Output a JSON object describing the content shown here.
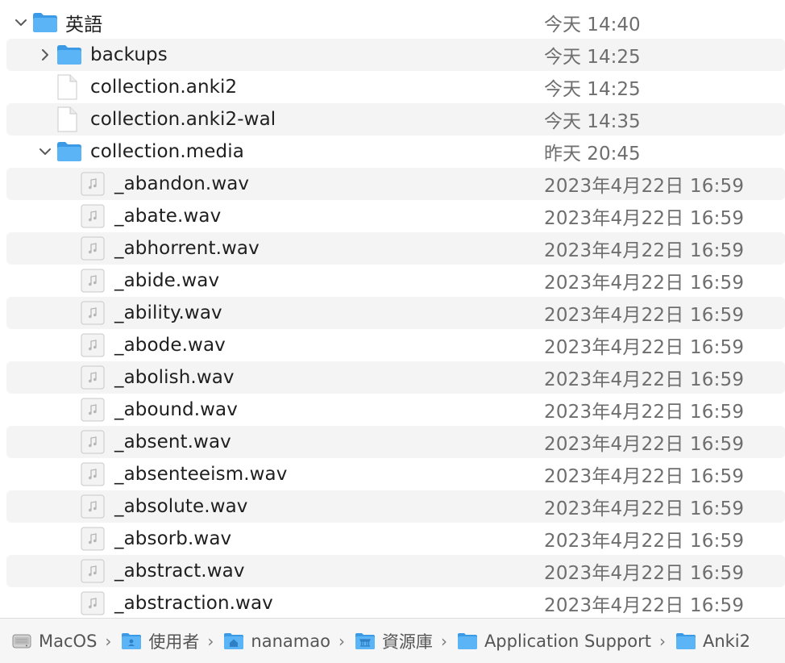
{
  "colors": {
    "folder_blue": "#4aa8f0",
    "folder_tab": "#62b6f5",
    "stripe": "#f4f4f5",
    "date_text": "#6e6e6e"
  },
  "rows": [
    {
      "name": "英語",
      "date": "今天 14:40",
      "type": "folder",
      "expanded": true,
      "icon": "folder-icon"
    },
    {
      "name": "backups",
      "date": "今天 14:25",
      "type": "folder",
      "expanded": false,
      "icon": "folder-icon"
    },
    {
      "name": "collection.anki2",
      "date": "今天 14:25",
      "type": "file",
      "icon": "document-icon"
    },
    {
      "name": "collection.anki2-wal",
      "date": "今天 14:35",
      "type": "file",
      "icon": "document-icon"
    },
    {
      "name": "collection.media",
      "date": "昨天 20:45",
      "type": "folder",
      "expanded": true,
      "icon": "folder-icon"
    },
    {
      "name": "_abandon.wav",
      "date": "2023年4月22日 16:59",
      "type": "audio",
      "icon": "audio-file-icon"
    },
    {
      "name": "_abate.wav",
      "date": "2023年4月22日 16:59",
      "type": "audio",
      "icon": "audio-file-icon"
    },
    {
      "name": "_abhorrent.wav",
      "date": "2023年4月22日 16:59",
      "type": "audio",
      "icon": "audio-file-icon"
    },
    {
      "name": "_abide.wav",
      "date": "2023年4月22日 16:59",
      "type": "audio",
      "icon": "audio-file-icon"
    },
    {
      "name": "_ability.wav",
      "date": "2023年4月22日 16:59",
      "type": "audio",
      "icon": "audio-file-icon"
    },
    {
      "name": "_abode.wav",
      "date": "2023年4月22日 16:59",
      "type": "audio",
      "icon": "audio-file-icon"
    },
    {
      "name": "_abolish.wav",
      "date": "2023年4月22日 16:59",
      "type": "audio",
      "icon": "audio-file-icon"
    },
    {
      "name": "_abound.wav",
      "date": "2023年4月22日 16:59",
      "type": "audio",
      "icon": "audio-file-icon"
    },
    {
      "name": "_absent.wav",
      "date": "2023年4月22日 16:59",
      "type": "audio",
      "icon": "audio-file-icon"
    },
    {
      "name": "_absenteeism.wav",
      "date": "2023年4月22日 16:59",
      "type": "audio",
      "icon": "audio-file-icon"
    },
    {
      "name": "_absolute.wav",
      "date": "2023年4月22日 16:59",
      "type": "audio",
      "icon": "audio-file-icon"
    },
    {
      "name": "_absorb.wav",
      "date": "2023年4月22日 16:59",
      "type": "audio",
      "icon": "audio-file-icon"
    },
    {
      "name": "_abstract.wav",
      "date": "2023年4月22日 16:59",
      "type": "audio",
      "icon": "audio-file-icon"
    },
    {
      "name": "_abstraction.wav",
      "date": "2023年4月22日 16:59",
      "type": "audio",
      "icon": "audio-file-icon"
    }
  ],
  "pathbar": {
    "crumbs": [
      {
        "label": "MacOS",
        "icon": "hard-drive-icon"
      },
      {
        "label": "使用者",
        "icon": "users-folder-icon"
      },
      {
        "label": "nanamao",
        "icon": "home-folder-icon"
      },
      {
        "label": "資源庫",
        "icon": "library-folder-icon"
      },
      {
        "label": "Application Support",
        "icon": "folder-icon"
      },
      {
        "label": "Anki2",
        "icon": "folder-icon"
      }
    ],
    "separator": "›"
  }
}
